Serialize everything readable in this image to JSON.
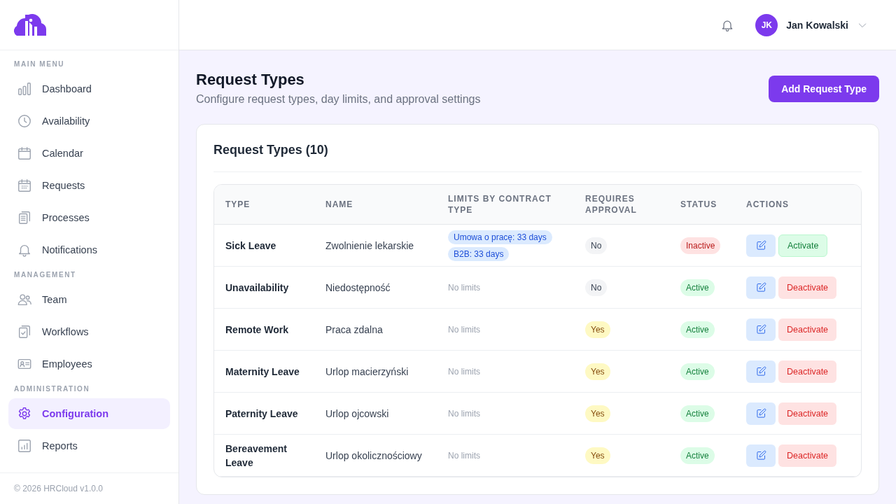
{
  "sidebar": {
    "sections": [
      {
        "heading": "MAIN MENU",
        "items": [
          {
            "label": "Dashboard",
            "selected": false
          },
          {
            "label": "Availability",
            "selected": false
          },
          {
            "label": "Calendar",
            "selected": false
          },
          {
            "label": "Requests",
            "selected": false
          },
          {
            "label": "Processes",
            "selected": false
          },
          {
            "label": "Notifications",
            "selected": false
          }
        ]
      },
      {
        "heading": "MANAGEMENT",
        "items": [
          {
            "label": "Team",
            "selected": false
          },
          {
            "label": "Workflows",
            "selected": false
          },
          {
            "label": "Employees",
            "selected": false
          }
        ]
      },
      {
        "heading": "ADMINISTRATION",
        "items": [
          {
            "label": "Configuration",
            "selected": true
          },
          {
            "label": "Reports",
            "selected": false
          }
        ]
      }
    ],
    "footer": "© 2026 HRCloud v1.0.0"
  },
  "header": {
    "user": {
      "initials": "JK",
      "name": "Jan Kowalski"
    }
  },
  "page": {
    "title": "Request Types",
    "subtitle": "Configure request types, day limits, and approval settings",
    "add_button": "Add Request Type"
  },
  "card": {
    "title": "Request Types (10)",
    "table": {
      "columns": [
        "TYPE",
        "NAME",
        "LIMITS BY CONTRACT TYPE",
        "REQUIRES APPROVAL",
        "STATUS",
        "ACTIONS"
      ],
      "rows": [
        {
          "type": "Sick Leave",
          "name": "Zwolnienie lekarskie",
          "limits": [
            "Umowa o pracę: 33 days",
            "B2B: 33 days"
          ],
          "approval": {
            "required": false,
            "label": "No"
          },
          "status": {
            "active": false,
            "label": "Inactive"
          },
          "action": "Activate"
        },
        {
          "type": "Unavailability",
          "name": "Niedostępność",
          "no_limits": "No limits",
          "approval": {
            "required": false,
            "label": "No"
          },
          "status": {
            "active": true,
            "label": "Active"
          },
          "action": "Deactivate"
        },
        {
          "type": "Remote Work",
          "name": "Praca zdalna",
          "no_limits": "No limits",
          "approval": {
            "required": true,
            "label": "Yes"
          },
          "status": {
            "active": true,
            "label": "Active"
          },
          "action": "Deactivate"
        },
        {
          "type": "Maternity Leave",
          "name": "Urlop macierzyński",
          "no_limits": "No limits",
          "approval": {
            "required": true,
            "label": "Yes"
          },
          "status": {
            "active": true,
            "label": "Active"
          },
          "action": "Deactivate"
        },
        {
          "type": "Paternity Leave",
          "name": "Urlop ojcowski",
          "no_limits": "No limits",
          "approval": {
            "required": true,
            "label": "Yes"
          },
          "status": {
            "active": true,
            "label": "Active"
          },
          "action": "Deactivate"
        },
        {
          "type": "Bereavement Leave",
          "name": "Urlop okolicznościowy",
          "no_limits": "No limits",
          "approval": {
            "required": true,
            "label": "Yes"
          },
          "status": {
            "active": true,
            "label": "Active"
          },
          "action": "Deactivate"
        }
      ]
    }
  }
}
